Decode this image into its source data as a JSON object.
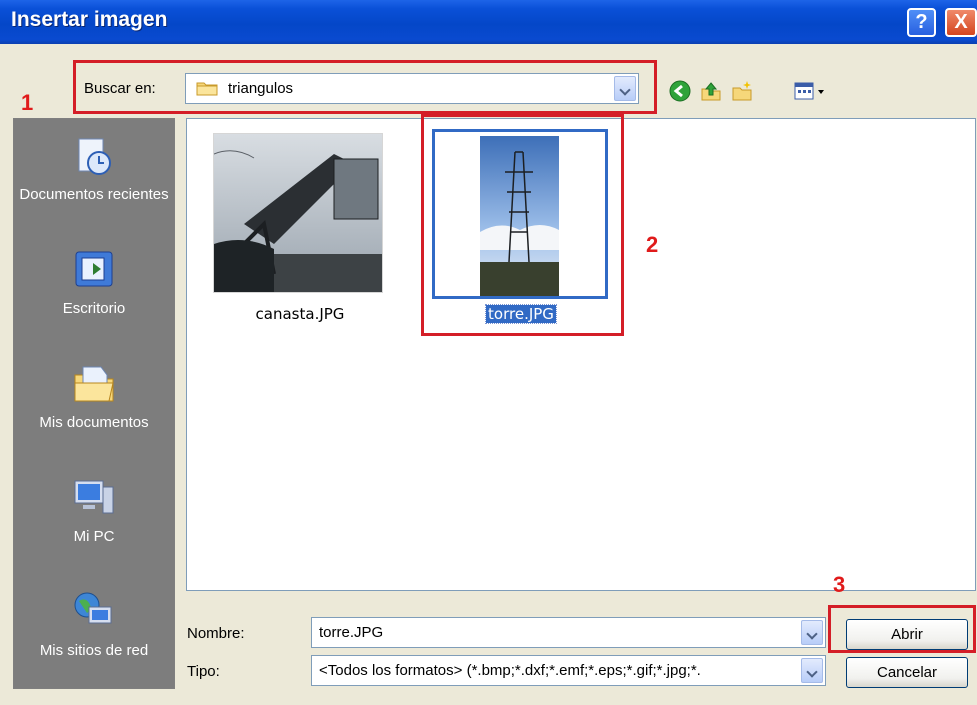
{
  "window": {
    "title": "Insertar imagen",
    "help_label": "?",
    "close_label": "X"
  },
  "lookin": {
    "label": "Buscar en:",
    "value": "triangulos"
  },
  "toolbar": {
    "icons": [
      "back-icon",
      "up-folder-icon",
      "new-folder-icon",
      "views-menu-icon"
    ]
  },
  "places": [
    {
      "label": "Documentos recientes",
      "icon": "recent-documents-icon"
    },
    {
      "label": "Escritorio",
      "icon": "desktop-icon"
    },
    {
      "label": "Mis documentos",
      "icon": "my-documents-icon"
    },
    {
      "label": "Mi PC",
      "icon": "my-computer-icon"
    },
    {
      "label": "Mis sitios de red",
      "icon": "network-places-icon"
    }
  ],
  "files": [
    {
      "name": "canasta.JPG",
      "selected": false
    },
    {
      "name": "torre.JPG",
      "selected": true
    }
  ],
  "filename": {
    "label": "Nombre:",
    "value": "torre.JPG"
  },
  "filetype": {
    "label": "Tipo:",
    "value": "<Todos los formatos> (*.bmp;*.dxf;*.emf;*.eps;*.gif;*.jpg;*."
  },
  "buttons": {
    "open": "Abrir",
    "cancel": "Cancelar"
  },
  "annotations": [
    "1",
    "2",
    "3"
  ],
  "colors": {
    "annotation": "#d41e27",
    "title_bar": "#0447c8",
    "selection": "#316ac5"
  }
}
